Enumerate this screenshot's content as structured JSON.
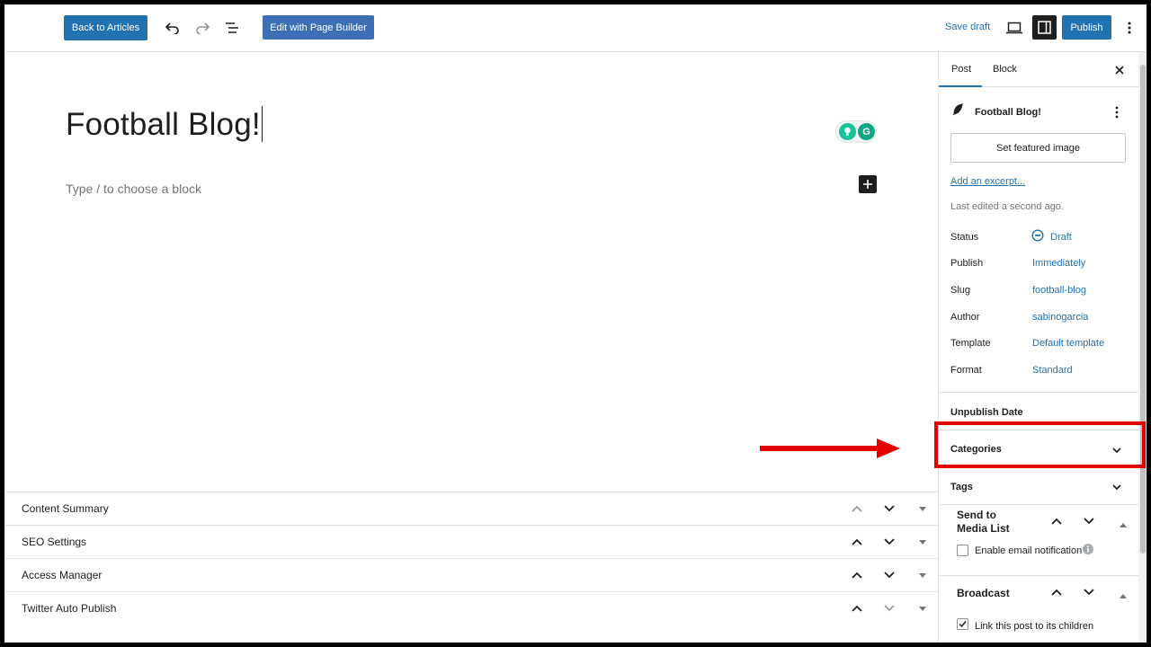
{
  "toolbar": {
    "back_label": "Back to Articles",
    "builder_label": "Edit with Page Builder",
    "save_draft_label": "Save draft",
    "publish_label": "Publish"
  },
  "editor": {
    "title": "Football Blog!",
    "block_placeholder": "Type / to choose a block"
  },
  "metaboxes": [
    {
      "label": "Content Summary"
    },
    {
      "label": "SEO Settings"
    },
    {
      "label": "Access Manager"
    },
    {
      "label": "Twitter Auto Publish"
    }
  ],
  "sidebar": {
    "tabs": [
      "Post",
      "Block"
    ],
    "post_title": "Football Blog!",
    "featured_image_label": "Set featured image",
    "excerpt_link": "Add an excerpt...",
    "last_edited": "Last edited a second ago.",
    "rows": [
      {
        "label": "Status",
        "value": "Draft"
      },
      {
        "label": "Publish",
        "value": "Immediately"
      },
      {
        "label": "Slug",
        "value": "football-blog"
      },
      {
        "label": "Author",
        "value": "sabinogarcia"
      },
      {
        "label": "Template",
        "value": "Default template"
      },
      {
        "label": "Format",
        "value": "Standard"
      }
    ],
    "unpublish_date": "Unpublish Date",
    "categories": "Categories",
    "tags": "Tags",
    "send_to_media_list_line1": "Send to",
    "send_to_media_list_line2": "Media List",
    "email_notification": "Enable email notification",
    "broadcast": "Broadcast",
    "link_children": "Link this post to its children"
  },
  "colors": {
    "primary": "#2271b1",
    "highlight": "#e30000"
  }
}
